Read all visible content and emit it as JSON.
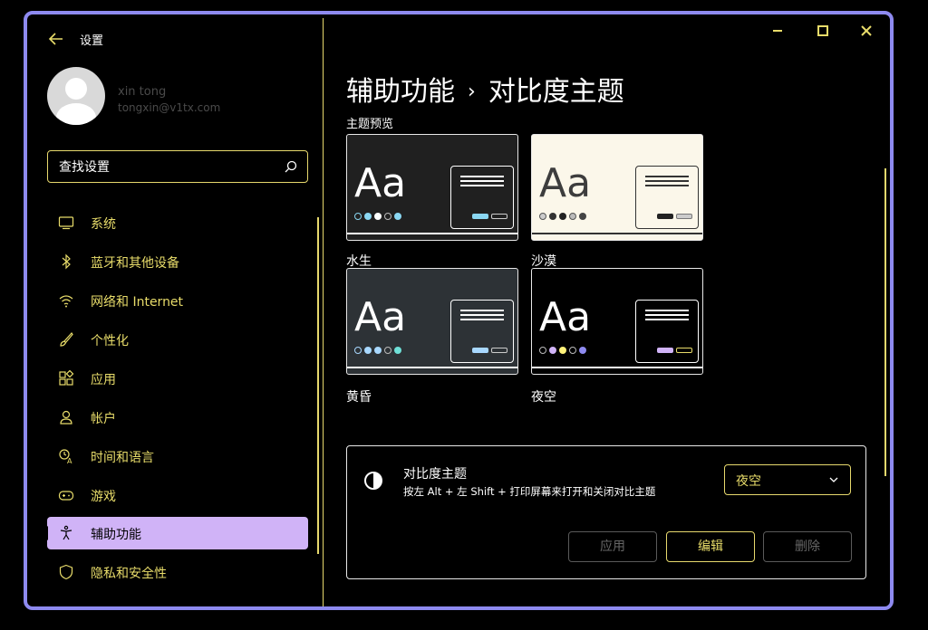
{
  "app": {
    "title": "设置"
  },
  "user": {
    "name": "xin tong",
    "email": "tongxin@v1tx.com"
  },
  "search": {
    "placeholder": "查找设置"
  },
  "nav": [
    {
      "label": "系统",
      "icon": "monitor-icon"
    },
    {
      "label": "蓝牙和其他设备",
      "icon": "bluetooth-icon"
    },
    {
      "label": "网络和 Internet",
      "icon": "wifi-icon"
    },
    {
      "label": "个性化",
      "icon": "brush-icon"
    },
    {
      "label": "应用",
      "icon": "apps-icon"
    },
    {
      "label": "帐户",
      "icon": "person-icon"
    },
    {
      "label": "时间和语言",
      "icon": "time-language-icon"
    },
    {
      "label": "游戏",
      "icon": "gamepad-icon"
    },
    {
      "label": "辅助功能",
      "icon": "accessibility-icon",
      "active": true
    },
    {
      "label": "隐私和安全性",
      "icon": "shield-icon"
    }
  ],
  "breadcrumb": {
    "parent": "辅助功能",
    "separator": "›",
    "current": "对比度主题"
  },
  "preview": {
    "label": "主题预览",
    "themes": [
      {
        "name": "水生",
        "sample": "Aa"
      },
      {
        "name": "沙漠",
        "sample": "Aa"
      },
      {
        "name": "黄昏",
        "sample": "Aa"
      },
      {
        "name": "夜空",
        "sample": "Aa"
      }
    ]
  },
  "contrast": {
    "title": "对比度主题",
    "subtitle": "按左 Alt + 左 Shift + 打印屏幕来打开和关闭对比主题",
    "selected": "夜空",
    "apply_label": "应用",
    "edit_label": "编辑",
    "delete_label": "删除"
  },
  "colors": {
    "accent_text": "#e8dc6a",
    "active_nav": "#d0b3f7",
    "window_border": "#8e8af0"
  }
}
